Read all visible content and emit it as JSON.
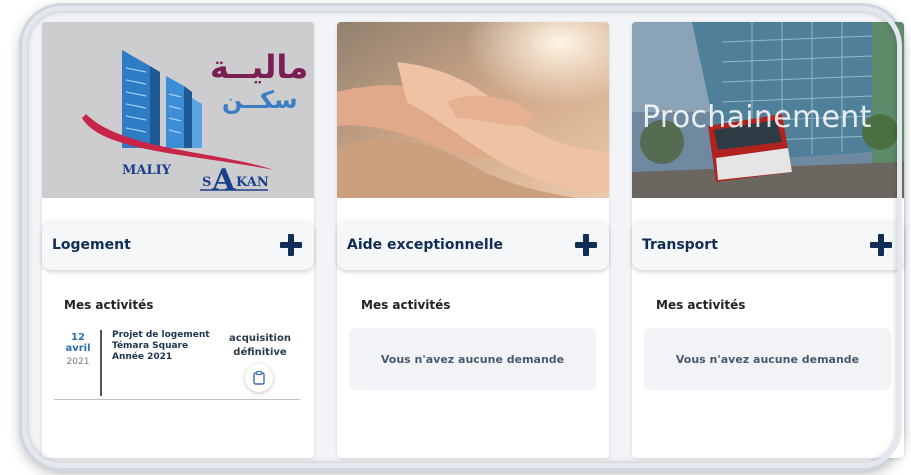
{
  "cards": [
    {
      "logo": {
        "arabic_top": "ماليــة",
        "arabic_bottom": "سكــن",
        "latin_part1": "MALIY",
        "latin_part2": "S",
        "latin_part3": "KAN",
        "latin_big_letter": "A"
      },
      "title": "Logement",
      "activities_title": "Mes activités",
      "activity": {
        "day_month": "12 avril",
        "year": "2021",
        "project": "Projet de logement Témara Square Année 2021",
        "status": "acquisition définitive"
      }
    },
    {
      "title": "Aide exceptionnelle",
      "activities_title": "Mes activités",
      "empty_message": "Vous n'avez aucune demande"
    },
    {
      "overlay_text": "Prochainement",
      "title": "Transport",
      "activities_title": "Mes activités",
      "empty_message": "Vous n'avez aucune demande"
    }
  ],
  "icons": {
    "add": "plus-icon",
    "document": "clipboard-icon"
  },
  "colors": {
    "accent": "#0f2d55",
    "date": "#2f6fb3",
    "logo_arabic": "#7a1f54",
    "logo_swoosh": "#c8254a"
  }
}
